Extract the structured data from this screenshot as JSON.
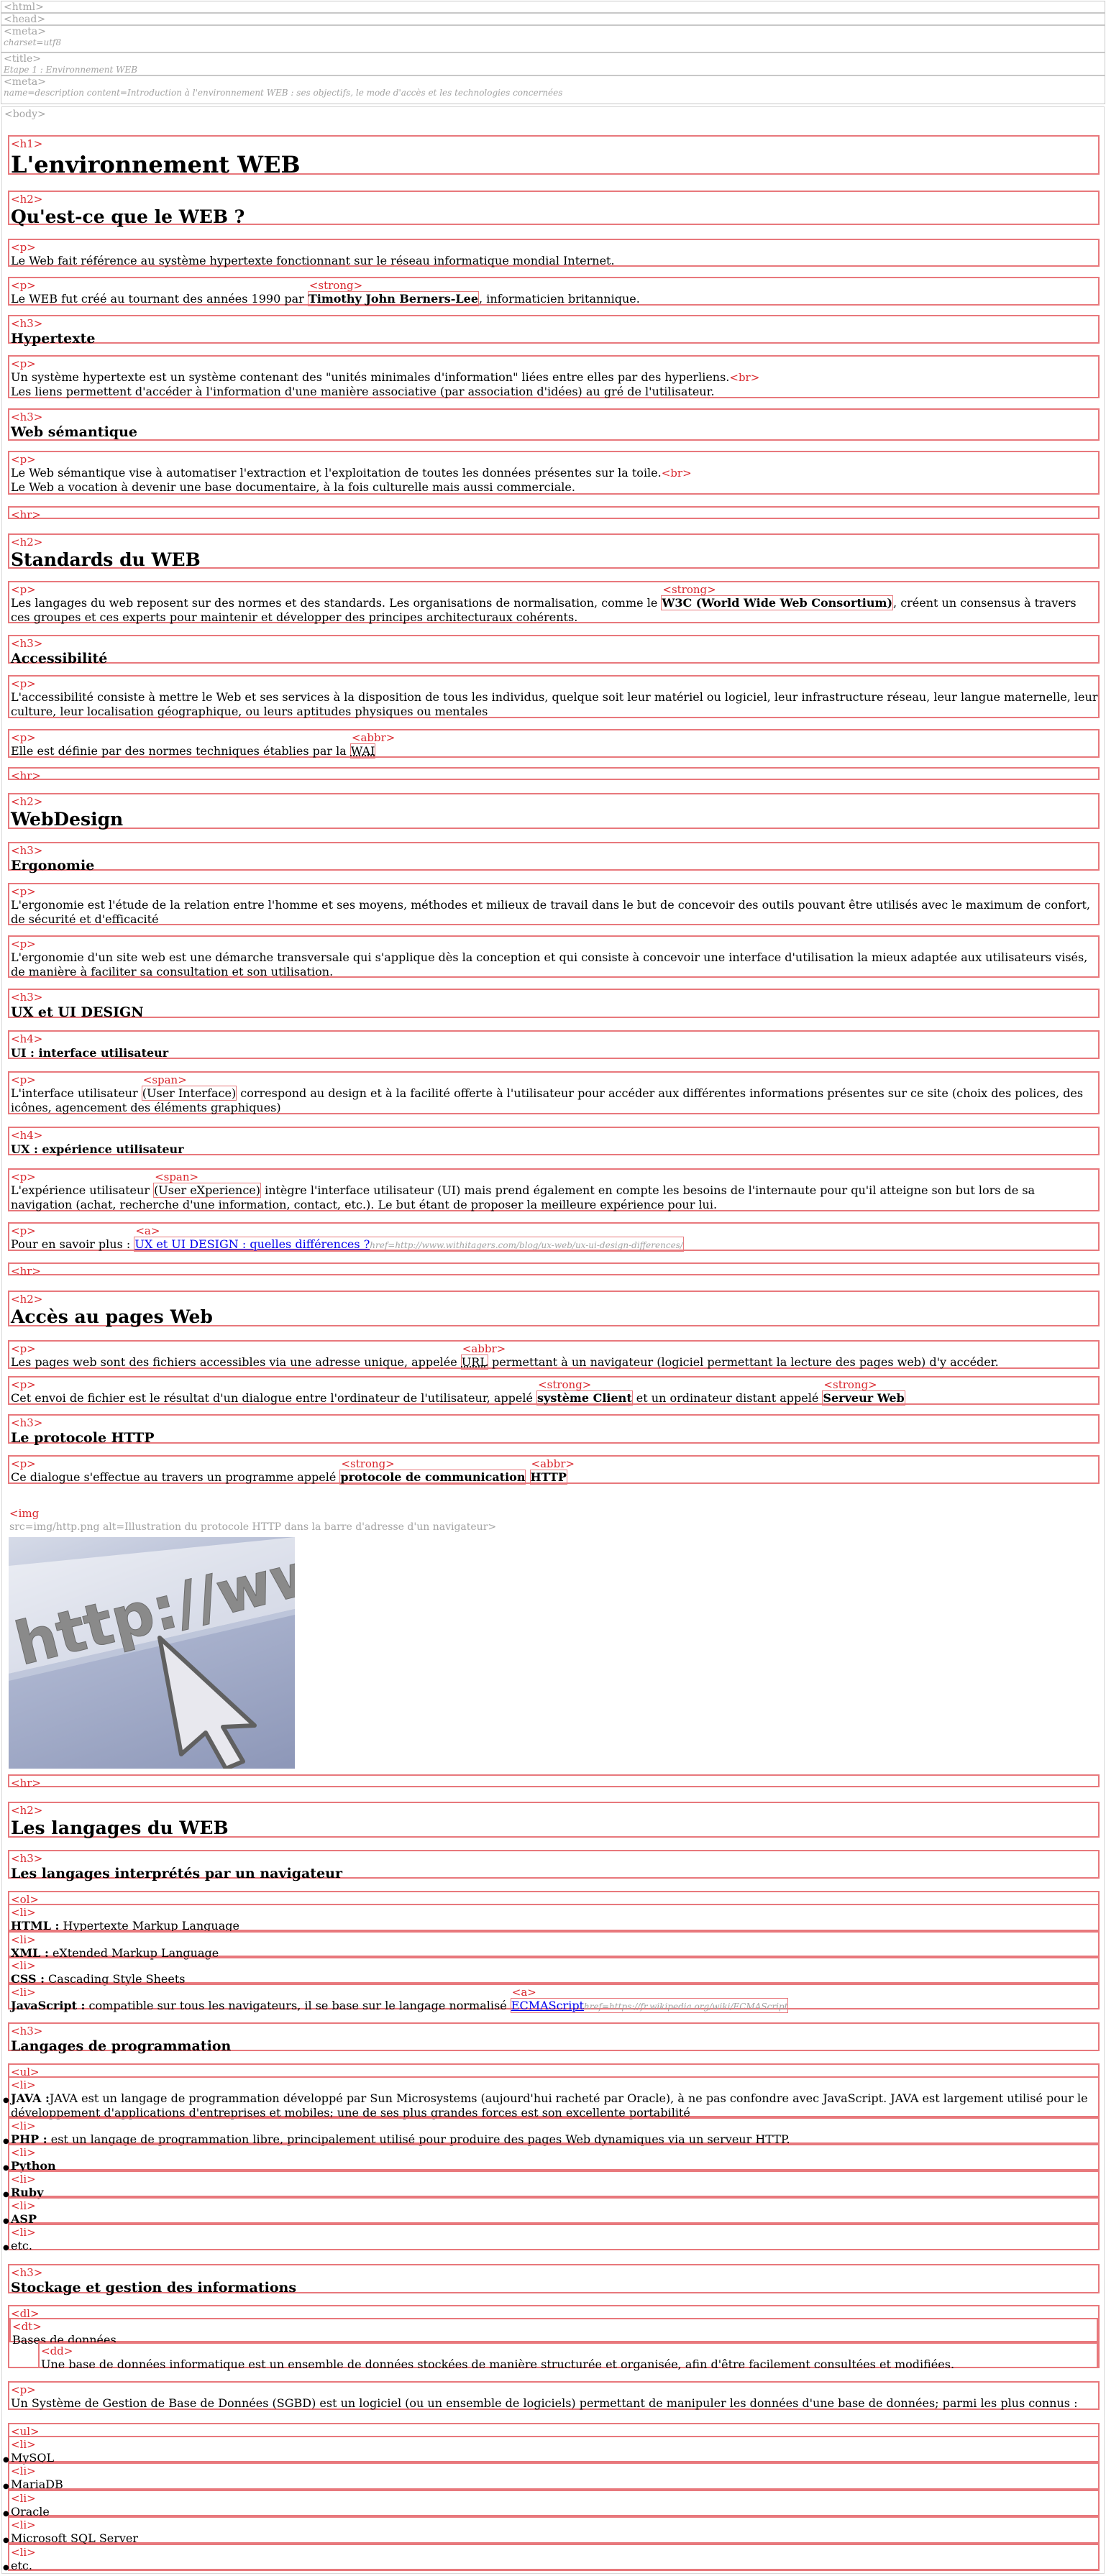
{
  "head": {
    "html_tag": "<html>",
    "head_tag": "<head>",
    "meta_tag": "<meta>",
    "meta_charset": "charset=utf8",
    "title_tag": "<title>",
    "title_text": "Etape 1 : Environnement WEB",
    "meta2_tag": "<meta>",
    "meta2_attr": "name=description content=Introduction à l'environnement WEB : ses objectifs, le mode d'accès et les technologies concernées"
  },
  "tags": {
    "body": "<body>",
    "h1": "<h1>",
    "h2": "<h2>",
    "h3": "<h3>",
    "h4": "<h4>",
    "p": "<p>",
    "strong": "<strong>",
    "br": "<br>",
    "hr": "<hr>",
    "abbr": "<abbr>",
    "span": "<span>",
    "a": "<a>",
    "img": "<img",
    "ol": "<ol>",
    "ul": "<ul>",
    "li": "<li>",
    "dl": "<dl>",
    "dt": "<dt>",
    "dd": "<dd>"
  },
  "h1": "L'environnement WEB",
  "s1": {
    "h2": "Qu'est-ce que le WEB ?",
    "p1": "Le Web fait référence au système hypertexte fonctionnant sur le réseau informatique mondial Internet.",
    "p2_before": "Le WEB fut créé au tournant des années 1990 par ",
    "p2_strong": "Timothy John Berners-Lee",
    "p2_after": ", informaticien britannique.",
    "h3a": "Hypertexte",
    "p3_line1": "Un système hypertexte est un système contenant des \"unités minimales d'information\" liées entre elles par des hyperliens.",
    "p3_line2": "Les liens permettent d'accéder à l'information d'une manière associative (par association d'idées) au gré de l'utilisateur.",
    "h3b": "Web sémantique",
    "p4_line1": "Le Web sémantique vise à automatiser l'extraction et l'exploitation de toutes les données présentes sur la toile.",
    "p4_line2": "Le Web a vocation à devenir une base documentaire, à la fois culturelle mais aussi commerciale."
  },
  "s2": {
    "h2": "Standards du WEB",
    "p1_before": "Les langages du web reposent sur des normes et des standards. Les organisations de normalisation, comme le ",
    "p1_strong": "W3C (World Wide Web Consortium)",
    "p1_after": ", créent un consensus à travers ces groupes et ces experts pour maintenir et développer des principes architecturaux cohérents.",
    "h3": "Accessibilité",
    "p2": "L'accessibilité consiste à mettre le Web et ses services à la disposition de tous les individus, quelque soit leur matériel ou logiciel, leur infrastructure réseau, leur langue maternelle, leur culture, leur localisation géographique, ou leurs aptitudes physiques ou mentales",
    "p3_before": "Elle est définie par des normes techniques établies par la ",
    "p3_abbr": "WAI"
  },
  "s3": {
    "h2": "WebDesign",
    "h3a": "Ergonomie",
    "p1": "L'ergonomie est l'étude de la relation entre l'homme et ses moyens, méthodes et milieux de travail dans le but de concevoir des outils pouvant être utilisés avec le maximum de confort, de sécurité et d'efficacité",
    "p2": "L'ergonomie d'un site web est une démarche transversale qui s'applique dès la conception et qui consiste à concevoir une interface d'utilisation la mieux adaptée aux utilisateurs visés, de manière à faciliter sa consultation et son utilisation.",
    "h3b": "UX et UI DESIGN",
    "h4a": "UI : interface utilisateur",
    "p3_before": "L'interface utilisateur ",
    "p3_span": "(User Interface)",
    "p3_after": " correspond au design et à la facilité offerte à l'utilisateur pour accéder aux différentes informations présentes sur ce site (choix des polices, des icônes, agencement des éléments graphiques)",
    "h4b": "UX : expérience utilisateur",
    "p4_before": "L'expérience utilisateur ",
    "p4_span": "(User eXperience)",
    "p4_after": " intègre l'interface utilisateur (UI) mais prend également en compte les besoins de l'internaute pour qu'il atteigne son but lors de sa navigation (achat, recherche d'une information, contact, etc.). Le but étant de proposer la meilleure expérience pour lui.",
    "p5_before": "Pour en savoir plus : ",
    "p5_link": "UX et UI DESIGN : quelles différences ?",
    "p5_href": "href=http://www.withitagers.com/blog/ux-web/ux-ui-design-differences/"
  },
  "s4": {
    "h2": "Accès au pages Web",
    "p1_before": "Les pages web sont des fichiers accessibles via une adresse unique, appelée ",
    "p1_abbr": "URL",
    "p1_after": " permettant à un navigateur (logiciel permettant la lecture des pages web) d'y accéder.",
    "p2_before": "Cet envoi de fichier est le résultat d'un dialogue entre l'ordinateur de l'utilisateur, appelé ",
    "p2_strong1": "système Client",
    "p2_mid": " et un ordinateur distant appelé ",
    "p2_strong2": "Serveur Web",
    "h3": "Le protocole HTTP",
    "p3_before": "Ce dialogue s'effectue au travers un programme appelé ",
    "p3_strong": "protocole de communication",
    "p3_mid": " ",
    "p3_abbr": "HTTP",
    "img_attr": "src=img/http.png alt=Illustration du protocole HTTP dans la barre d'adresse d'un navigateur>",
    "img_text": "http://www"
  },
  "s5": {
    "h2": "Les langages du WEB",
    "h3a": "Les langages interprétés par un navigateur",
    "ol": [
      {
        "strong": "HTML :",
        "text": " Hypertexte Markup Language"
      },
      {
        "strong": "XML :",
        "text": " eXtended Markup Language"
      },
      {
        "strong": "CSS :",
        "text": " Cascading Style Sheets"
      }
    ],
    "js_strong": "JavaScript :",
    "js_text": " compatible sur tous les navigateurs, il se base sur le langage normalisé ",
    "js_link": "ECMAScript",
    "js_href": "href=https://fr.wikipedia.org/wiki/ECMAScript",
    "h3b": "Langages de programmation",
    "ul1_java_strong": "JAVA :",
    "ul1_java_text": "JAVA est un langage de programmation développé par Sun Microsystems (aujourd'hui racheté par Oracle), à ne pas confondre avec JavaScript. JAVA est largement utilisé pour le développement d'applications d'entreprises et mobiles; une de ses plus grandes forces est son excellente portabilité",
    "ul1_php_strong": "PHP :",
    "ul1_php_text": " est un langage de programmation libre, principalement utilisé pour produire des pages Web dynamiques via un serveur HTTP.",
    "ul1_more": [
      "Python",
      "Ruby",
      "ASP"
    ],
    "ul1_etc": "etc.",
    "h3c": "Stockage et gestion des informations",
    "dt": "Bases de données",
    "dd": "Une base de données informatique est un ensemble de données stockées de manière structurée et organisée, afin d'être facilement consultées et modifiées.",
    "p_sgbd": "Un Système de Gestion de Base de Données (SGBD) est un logiciel (ou un ensemble de logiciels) permettant de manipuler les données d'une base de données; parmi les plus connus :",
    "ul2": [
      "MySQL",
      "MariaDB",
      "Oracle",
      "Microsoft SQL Server",
      "etc."
    ]
  },
  "colors": {
    "outline": "#e8787c",
    "tag": "#d9262c",
    "link": "#0000ee",
    "muted": "#a3a3a3"
  }
}
